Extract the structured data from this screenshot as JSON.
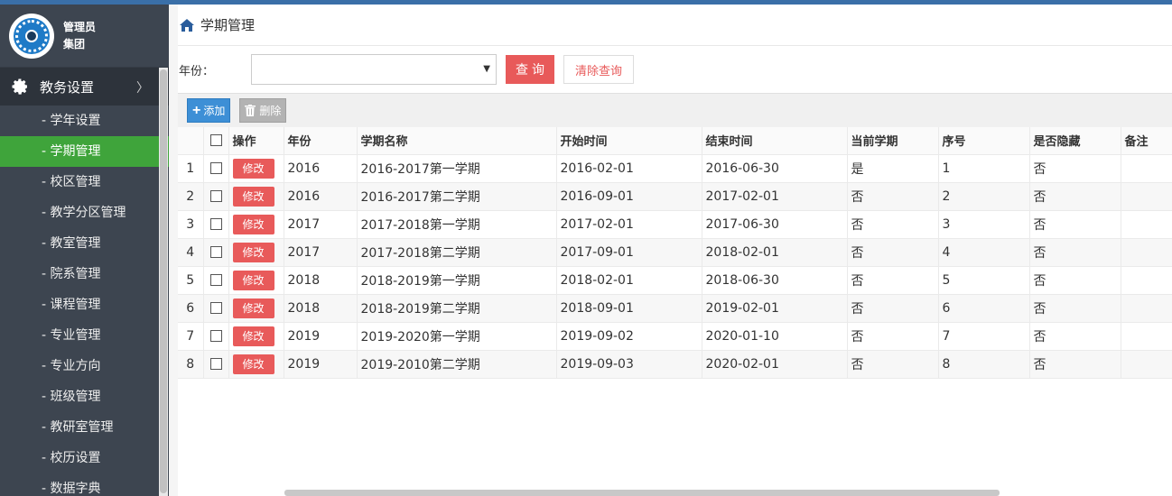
{
  "user": {
    "role": "管理员",
    "org": "集团"
  },
  "menu": {
    "header": "教务设置",
    "items": [
      {
        "label": "- 学年设置",
        "active": false
      },
      {
        "label": "- 学期管理",
        "active": true
      },
      {
        "label": "- 校区管理",
        "active": false
      },
      {
        "label": "- 教学分区管理",
        "active": false
      },
      {
        "label": "- 教室管理",
        "active": false
      },
      {
        "label": "- 院系管理",
        "active": false
      },
      {
        "label": "- 课程管理",
        "active": false
      },
      {
        "label": "- 专业管理",
        "active": false
      },
      {
        "label": "- 专业方向",
        "active": false
      },
      {
        "label": "- 班级管理",
        "active": false
      },
      {
        "label": "- 教研室管理",
        "active": false
      },
      {
        "label": "- 校历设置",
        "active": false
      },
      {
        "label": "- 数据字典",
        "active": false
      }
    ]
  },
  "breadcrumb": {
    "title": "学期管理"
  },
  "query": {
    "year_label": "年份：",
    "year_value": "",
    "query_button": "查询",
    "clear_button": "清除查询"
  },
  "toolbar": {
    "add_label": "添加",
    "delete_label": "删除"
  },
  "table": {
    "columns": [
      "操作",
      "年份",
      "学期名称",
      "开始时间",
      "结束时间",
      "当前学期",
      "序号",
      "是否隐藏",
      "备注"
    ],
    "edit_label": "修改",
    "rows": [
      {
        "idx": "1",
        "year": "2016",
        "name": "2016-2017第一学期",
        "start": "2016-02-01",
        "end": "2016-06-30",
        "current": "是",
        "seq": "1",
        "hidden": "否",
        "note": ""
      },
      {
        "idx": "2",
        "year": "2016",
        "name": "2016-2017第二学期",
        "start": "2016-09-01",
        "end": "2017-02-01",
        "current": "否",
        "seq": "2",
        "hidden": "否",
        "note": ""
      },
      {
        "idx": "3",
        "year": "2017",
        "name": "2017-2018第一学期",
        "start": "2017-02-01",
        "end": "2017-06-30",
        "current": "否",
        "seq": "3",
        "hidden": "否",
        "note": ""
      },
      {
        "idx": "4",
        "year": "2017",
        "name": "2017-2018第二学期",
        "start": "2017-09-01",
        "end": "2018-02-01",
        "current": "否",
        "seq": "4",
        "hidden": "否",
        "note": ""
      },
      {
        "idx": "5",
        "year": "2018",
        "name": "2018-2019第一学期",
        "start": "2018-02-01",
        "end": "2018-06-30",
        "current": "否",
        "seq": "5",
        "hidden": "否",
        "note": ""
      },
      {
        "idx": "6",
        "year": "2018",
        "name": "2018-2019第二学期",
        "start": "2018-09-01",
        "end": "2019-02-01",
        "current": "否",
        "seq": "6",
        "hidden": "否",
        "note": ""
      },
      {
        "idx": "7",
        "year": "2019",
        "name": "2019-2020第一学期",
        "start": "2019-09-02",
        "end": "2020-01-10",
        "current": "否",
        "seq": "7",
        "hidden": "否",
        "note": ""
      },
      {
        "idx": "8",
        "year": "2019",
        "name": "2019-2010第二学期",
        "start": "2019-09-03",
        "end": "2020-02-01",
        "current": "否",
        "seq": "8",
        "hidden": "否",
        "note": ""
      }
    ]
  },
  "colors": {
    "accent_green": "#3fa43b",
    "danger": "#e85a5a",
    "primary": "#3d8fd6",
    "sidebar": "#3d4550"
  }
}
